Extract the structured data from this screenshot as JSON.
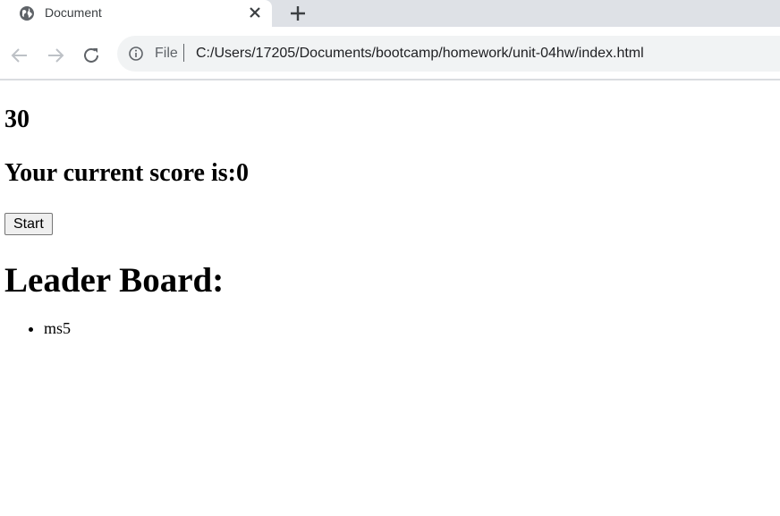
{
  "browser": {
    "tab_title": "Document",
    "scheme_label": "File",
    "url": "C:/Users/17205/Documents/bootcamp/homework/unit-04hw/index.html"
  },
  "page": {
    "timer": "30",
    "score_text": "Your current score is:0",
    "start_label": "Start",
    "leaderboard_title": "Leader Board:",
    "leaderboard": [
      {
        "entry": "ms5"
      }
    ]
  }
}
